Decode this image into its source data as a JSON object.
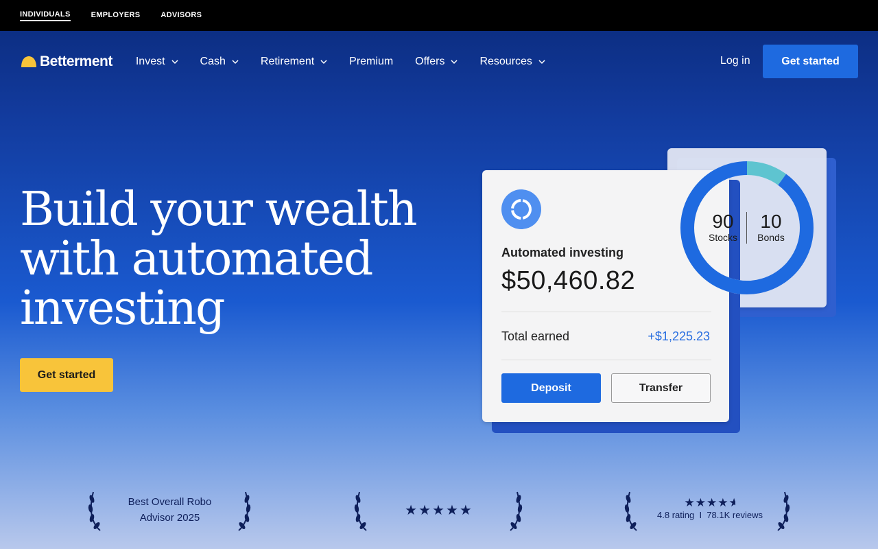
{
  "topbar": {
    "links": [
      "INDIVIDUALS",
      "EMPLOYERS",
      "ADVISORS"
    ],
    "active_index": 0
  },
  "nav": {
    "brand": "Betterment",
    "items": [
      {
        "label": "Invest",
        "has_dropdown": true
      },
      {
        "label": "Cash",
        "has_dropdown": true
      },
      {
        "label": "Retirement",
        "has_dropdown": true
      },
      {
        "label": "Premium",
        "has_dropdown": false
      },
      {
        "label": "Offers",
        "has_dropdown": true
      },
      {
        "label": "Resources",
        "has_dropdown": true
      }
    ],
    "login_label": "Log in",
    "cta_label": "Get started"
  },
  "hero": {
    "title_lines": [
      "Build your wealth",
      "with automated",
      "investing"
    ],
    "cta_label": "Get started"
  },
  "account_card": {
    "label": "Automated investing",
    "balance": "$50,460.82",
    "earned_label": "Total earned",
    "earned_value": "+$1,225.23",
    "deposit_label": "Deposit",
    "transfer_label": "Transfer"
  },
  "allocation_card": {
    "stocks_value": "90",
    "stocks_label": "Stocks",
    "bonds_value": "10",
    "bonds_label": "Bonds",
    "stocks_fraction": 0.9,
    "colors": {
      "stocks": "#1e6ae0",
      "bonds": "#5ec4d0"
    }
  },
  "awards": {
    "first_line1": "Best Overall Robo",
    "first_line2": "Advisor 2025",
    "second_stars": "★★★★★",
    "third_stars": "★★★★",
    "third_rating": "4.8 rating",
    "third_separator": "I",
    "third_reviews": "78.1K reviews"
  },
  "colors": {
    "accent_blue": "#1e6ae0",
    "cta_yellow": "#f8c43a",
    "navy": "#0e1f5a"
  }
}
